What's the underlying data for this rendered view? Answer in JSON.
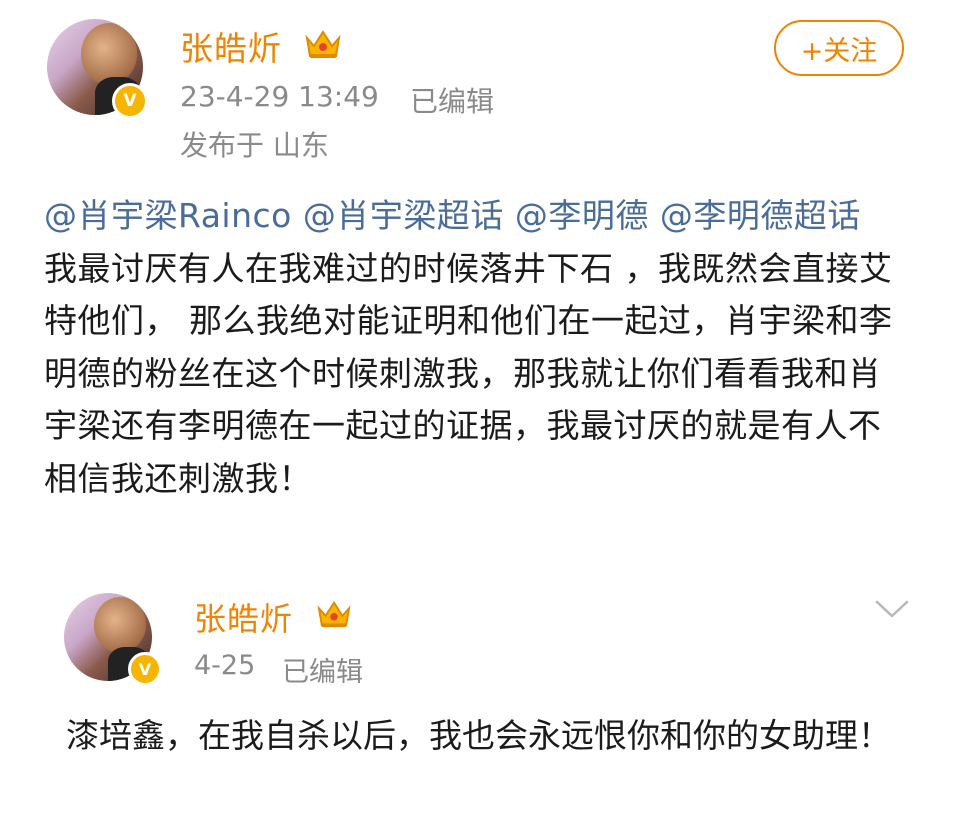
{
  "post": {
    "author": "张皓炘",
    "timestamp": "23-4-29 13:49",
    "edited": "已编辑",
    "location": "发布于 山东",
    "follow_label": "+关注",
    "mentions": [
      "@肖宇梁Rainco",
      "@肖宇梁超话",
      "@李明德",
      "@李明德超话"
    ],
    "body": " 我最讨厌有人在我难过的时候落井下石 ，我既然会直接艾特他们， 那么我绝对能证明和他们在一起过，肖宇梁和李明德的粉丝在这个时候刺激我，那我就让你们看看我和肖宇梁还有李明德在一起过的证据，我最讨厌的就是有人不相信我还刺激我！"
  },
  "reply": {
    "author": "张皓炘",
    "timestamp": "4-25",
    "edited": "已编辑",
    "body": "漆培鑫，在我自杀以后，我也会永远恨你和你的女助理！"
  },
  "icons": {
    "verified": "verified-badge-icon",
    "crown": "crown-icon",
    "more": "chevron-down-icon"
  },
  "colors": {
    "accent": "#f08300",
    "mention": "#4a6c9a",
    "meta": "#8a8a8a"
  }
}
